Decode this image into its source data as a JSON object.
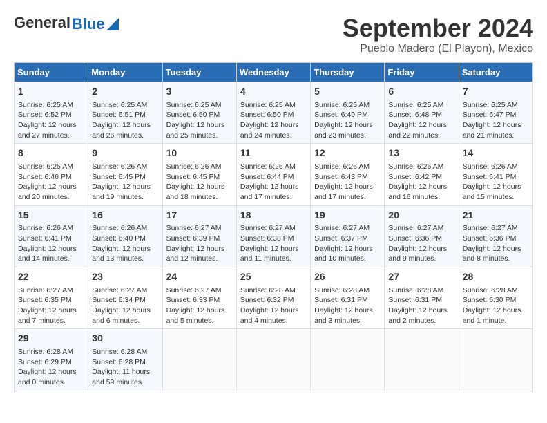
{
  "header": {
    "logo_general": "General",
    "logo_blue": "Blue",
    "title": "September 2024",
    "subtitle": "Pueblo Madero (El Playon), Mexico"
  },
  "days_of_week": [
    "Sunday",
    "Monday",
    "Tuesday",
    "Wednesday",
    "Thursday",
    "Friday",
    "Saturday"
  ],
  "weeks": [
    [
      {
        "day": "1",
        "lines": [
          "Sunrise: 6:25 AM",
          "Sunset: 6:52 PM",
          "Daylight: 12 hours",
          "and 27 minutes."
        ]
      },
      {
        "day": "2",
        "lines": [
          "Sunrise: 6:25 AM",
          "Sunset: 6:51 PM",
          "Daylight: 12 hours",
          "and 26 minutes."
        ]
      },
      {
        "day": "3",
        "lines": [
          "Sunrise: 6:25 AM",
          "Sunset: 6:50 PM",
          "Daylight: 12 hours",
          "and 25 minutes."
        ]
      },
      {
        "day": "4",
        "lines": [
          "Sunrise: 6:25 AM",
          "Sunset: 6:50 PM",
          "Daylight: 12 hours",
          "and 24 minutes."
        ]
      },
      {
        "day": "5",
        "lines": [
          "Sunrise: 6:25 AM",
          "Sunset: 6:49 PM",
          "Daylight: 12 hours",
          "and 23 minutes."
        ]
      },
      {
        "day": "6",
        "lines": [
          "Sunrise: 6:25 AM",
          "Sunset: 6:48 PM",
          "Daylight: 12 hours",
          "and 22 minutes."
        ]
      },
      {
        "day": "7",
        "lines": [
          "Sunrise: 6:25 AM",
          "Sunset: 6:47 PM",
          "Daylight: 12 hours",
          "and 21 minutes."
        ]
      }
    ],
    [
      {
        "day": "8",
        "lines": [
          "Sunrise: 6:25 AM",
          "Sunset: 6:46 PM",
          "Daylight: 12 hours",
          "and 20 minutes."
        ]
      },
      {
        "day": "9",
        "lines": [
          "Sunrise: 6:26 AM",
          "Sunset: 6:45 PM",
          "Daylight: 12 hours",
          "and 19 minutes."
        ]
      },
      {
        "day": "10",
        "lines": [
          "Sunrise: 6:26 AM",
          "Sunset: 6:45 PM",
          "Daylight: 12 hours",
          "and 18 minutes."
        ]
      },
      {
        "day": "11",
        "lines": [
          "Sunrise: 6:26 AM",
          "Sunset: 6:44 PM",
          "Daylight: 12 hours",
          "and 17 minutes."
        ]
      },
      {
        "day": "12",
        "lines": [
          "Sunrise: 6:26 AM",
          "Sunset: 6:43 PM",
          "Daylight: 12 hours",
          "and 17 minutes."
        ]
      },
      {
        "day": "13",
        "lines": [
          "Sunrise: 6:26 AM",
          "Sunset: 6:42 PM",
          "Daylight: 12 hours",
          "and 16 minutes."
        ]
      },
      {
        "day": "14",
        "lines": [
          "Sunrise: 6:26 AM",
          "Sunset: 6:41 PM",
          "Daylight: 12 hours",
          "and 15 minutes."
        ]
      }
    ],
    [
      {
        "day": "15",
        "lines": [
          "Sunrise: 6:26 AM",
          "Sunset: 6:41 PM",
          "Daylight: 12 hours",
          "and 14 minutes."
        ]
      },
      {
        "day": "16",
        "lines": [
          "Sunrise: 6:26 AM",
          "Sunset: 6:40 PM",
          "Daylight: 12 hours",
          "and 13 minutes."
        ]
      },
      {
        "day": "17",
        "lines": [
          "Sunrise: 6:27 AM",
          "Sunset: 6:39 PM",
          "Daylight: 12 hours",
          "and 12 minutes."
        ]
      },
      {
        "day": "18",
        "lines": [
          "Sunrise: 6:27 AM",
          "Sunset: 6:38 PM",
          "Daylight: 12 hours",
          "and 11 minutes."
        ]
      },
      {
        "day": "19",
        "lines": [
          "Sunrise: 6:27 AM",
          "Sunset: 6:37 PM",
          "Daylight: 12 hours",
          "and 10 minutes."
        ]
      },
      {
        "day": "20",
        "lines": [
          "Sunrise: 6:27 AM",
          "Sunset: 6:36 PM",
          "Daylight: 12 hours",
          "and 9 minutes."
        ]
      },
      {
        "day": "21",
        "lines": [
          "Sunrise: 6:27 AM",
          "Sunset: 6:36 PM",
          "Daylight: 12 hours",
          "and 8 minutes."
        ]
      }
    ],
    [
      {
        "day": "22",
        "lines": [
          "Sunrise: 6:27 AM",
          "Sunset: 6:35 PM",
          "Daylight: 12 hours",
          "and 7 minutes."
        ]
      },
      {
        "day": "23",
        "lines": [
          "Sunrise: 6:27 AM",
          "Sunset: 6:34 PM",
          "Daylight: 12 hours",
          "and 6 minutes."
        ]
      },
      {
        "day": "24",
        "lines": [
          "Sunrise: 6:27 AM",
          "Sunset: 6:33 PM",
          "Daylight: 12 hours",
          "and 5 minutes."
        ]
      },
      {
        "day": "25",
        "lines": [
          "Sunrise: 6:28 AM",
          "Sunset: 6:32 PM",
          "Daylight: 12 hours",
          "and 4 minutes."
        ]
      },
      {
        "day": "26",
        "lines": [
          "Sunrise: 6:28 AM",
          "Sunset: 6:31 PM",
          "Daylight: 12 hours",
          "and 3 minutes."
        ]
      },
      {
        "day": "27",
        "lines": [
          "Sunrise: 6:28 AM",
          "Sunset: 6:31 PM",
          "Daylight: 12 hours",
          "and 2 minutes."
        ]
      },
      {
        "day": "28",
        "lines": [
          "Sunrise: 6:28 AM",
          "Sunset: 6:30 PM",
          "Daylight: 12 hours",
          "and 1 minute."
        ]
      }
    ],
    [
      {
        "day": "29",
        "lines": [
          "Sunrise: 6:28 AM",
          "Sunset: 6:29 PM",
          "Daylight: 12 hours",
          "and 0 minutes."
        ]
      },
      {
        "day": "30",
        "lines": [
          "Sunrise: 6:28 AM",
          "Sunset: 6:28 PM",
          "Daylight: 11 hours",
          "and 59 minutes."
        ]
      },
      {
        "day": "",
        "lines": []
      },
      {
        "day": "",
        "lines": []
      },
      {
        "day": "",
        "lines": []
      },
      {
        "day": "",
        "lines": []
      },
      {
        "day": "",
        "lines": []
      }
    ]
  ]
}
